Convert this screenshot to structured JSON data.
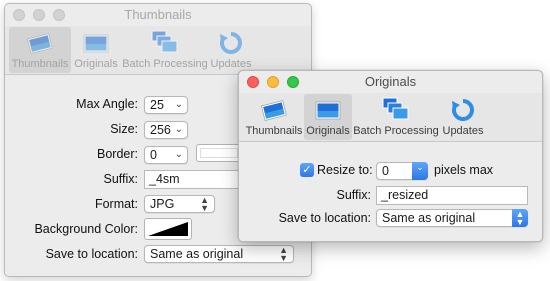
{
  "back_window": {
    "title": "Thumbnails",
    "tabs": [
      {
        "label": "Thumbnails",
        "icon": "thumbnails-icon",
        "selected": true
      },
      {
        "label": "Originals",
        "icon": "originals-icon",
        "selected": false
      },
      {
        "label": "Batch Processing",
        "icon": "batch-processing-icon",
        "selected": false
      },
      {
        "label": "Updates",
        "icon": "updates-icon",
        "selected": false
      }
    ],
    "form": {
      "max_angle_label": "Max Angle:",
      "max_angle_value": "25",
      "size_label": "Size:",
      "size_value": "256",
      "border_label": "Border:",
      "border_value": "0",
      "suffix_label": "Suffix:",
      "suffix_value": "_4sm",
      "format_label": "Format:",
      "format_value": "JPG",
      "background_label": "Background Color:",
      "save_label": "Save to location:",
      "save_value": "Same as original"
    }
  },
  "front_window": {
    "title": "Originals",
    "tabs": [
      {
        "label": "Thumbnails",
        "icon": "thumbnails-icon",
        "selected": false
      },
      {
        "label": "Originals",
        "icon": "originals-icon",
        "selected": true
      },
      {
        "label": "Batch Processing",
        "icon": "batch-processing-icon",
        "selected": false
      },
      {
        "label": "Updates",
        "icon": "updates-icon",
        "selected": false
      }
    ],
    "form": {
      "resize_label": "Resize to:",
      "resize_checked": true,
      "resize_value": "0",
      "resize_unit": "pixels max",
      "suffix_label": "Suffix:",
      "suffix_value": "_resized",
      "save_label": "Save to location:",
      "save_value": "Same as original"
    }
  },
  "colors": {
    "accent": "#2e77e6",
    "window_bg": "#ececec",
    "close": "#fc605c",
    "minimize": "#fdbc40",
    "zoom": "#34c84a"
  }
}
